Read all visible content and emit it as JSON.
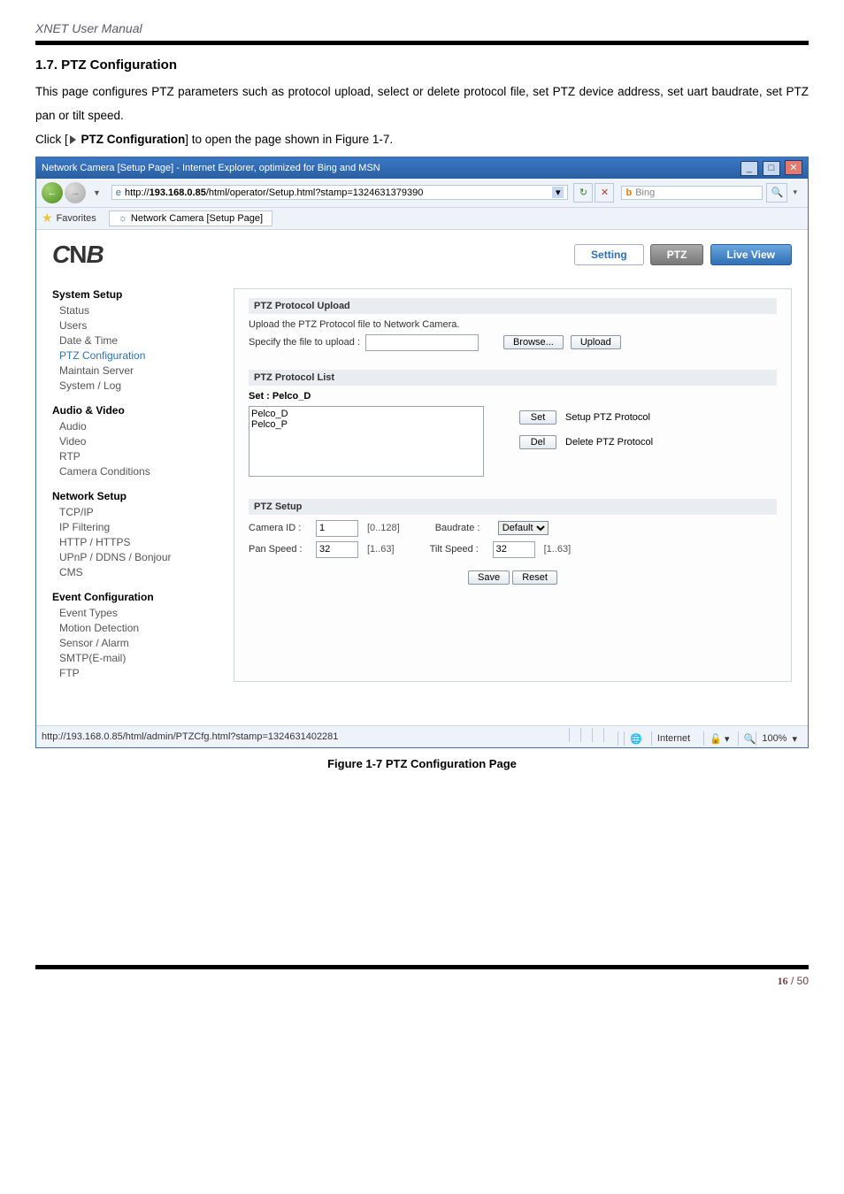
{
  "doc": {
    "title": "XNET User Manual",
    "heading": "1.7. PTZ Configuration",
    "para1": "This page configures PTZ parameters such as protocol upload, select or delete protocol file, set PTZ device address, set uart baudrate, set PTZ pan or tilt speed.",
    "para2_prefix": "Click [",
    "para2_link": "PTZ Configuration",
    "para2_suffix": "] to open the page shown in Figure 1-7.",
    "caption": "Figure 1-7 PTZ Configuration Page",
    "page_cur": "16",
    "page_sep": " / ",
    "page_total": "50"
  },
  "browser": {
    "title": "Network Camera [Setup Page] - Internet Explorer, optimized for Bing and MSN",
    "url_prefix": "http://",
    "url_bold": "193.168.0.85",
    "url_suffix": "/html/operator/Setup.html?stamp=1324631379390",
    "search_placeholder": "Bing",
    "fav_label": "Favorites",
    "tab": "Network Camera [Setup Page]",
    "status_url": "http://193.168.0.85/html/admin/PTZCfg.html?stamp=1324631402281",
    "status_zone": "Internet",
    "status_zoom": "100%"
  },
  "nav": {
    "setting": "Setting",
    "ptz": "PTZ",
    "live": "Live View"
  },
  "sidebar": {
    "g1": "System Setup",
    "g1_items": [
      "Status",
      "Users",
      "Date & Time",
      "PTZ Configuration",
      "Maintain Server",
      "System / Log"
    ],
    "g2": "Audio & Video",
    "g2_items": [
      "Audio",
      "Video",
      "RTP",
      "Camera Conditions"
    ],
    "g3": "Network Setup",
    "g3_items": [
      "TCP/IP",
      "IP Filtering",
      "HTTP / HTTPS",
      "UPnP / DDNS / Bonjour",
      "CMS"
    ],
    "g4": "Event Configuration",
    "g4_items": [
      "Event Types",
      "Motion Detection",
      "Sensor / Alarm",
      "SMTP(E-mail)",
      "FTP"
    ]
  },
  "panel": {
    "h1": "PTZ Protocol Upload",
    "upload_desc": "Upload the PTZ Protocol file to Network Camera.",
    "upload_label": "Specify the file to upload :",
    "browse": "Browse...",
    "upload": "Upload",
    "h2": "PTZ Protocol List",
    "set_label": "Set : Pelco_D",
    "list_items": [
      "Pelco_D",
      "Pelco_P"
    ],
    "set_btn": "Set",
    "set_desc": "Setup PTZ Protocol",
    "del_btn": "Del",
    "del_desc": "Delete PTZ Protocol",
    "h3": "PTZ Setup",
    "cam_label": "Camera ID :",
    "cam_val": "1",
    "cam_range": "[0..128]",
    "baud_label": "Baudrate :",
    "baud_val": "Default",
    "pan_label": "Pan Speed :",
    "pan_val": "32",
    "pan_range": "[1..63]",
    "tilt_label": "Tilt Speed :",
    "tilt_val": "32",
    "tilt_range": "[1..63]",
    "save": "Save",
    "reset": "Reset"
  }
}
